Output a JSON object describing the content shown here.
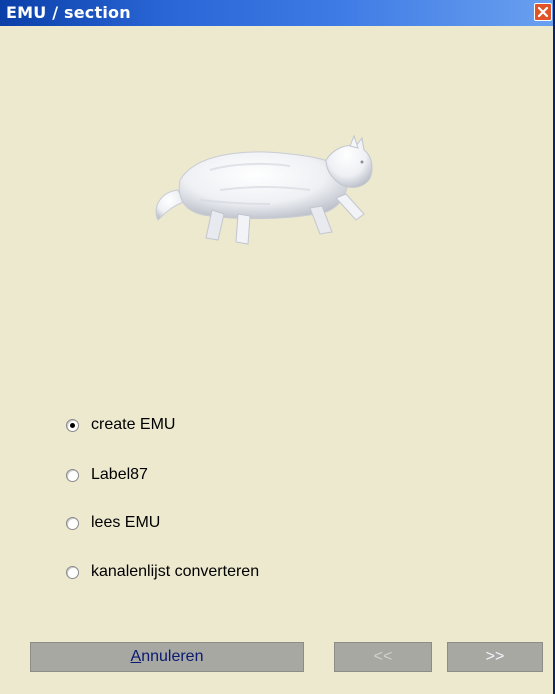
{
  "window": {
    "title": "EMU / section",
    "close_glyph": "✕"
  },
  "options": [
    {
      "label": "create EMU",
      "checked": true
    },
    {
      "label": "Label87",
      "checked": false
    },
    {
      "label": "lees EMU",
      "checked": false
    },
    {
      "label": "kanalenlijst converteren",
      "checked": false
    }
  ],
  "buttons": {
    "cancel_access_key": "A",
    "cancel_rest": "nnuleren",
    "prev_label": "<<",
    "next_label": ">>"
  },
  "image": {
    "icon": "white-cat-icon"
  }
}
